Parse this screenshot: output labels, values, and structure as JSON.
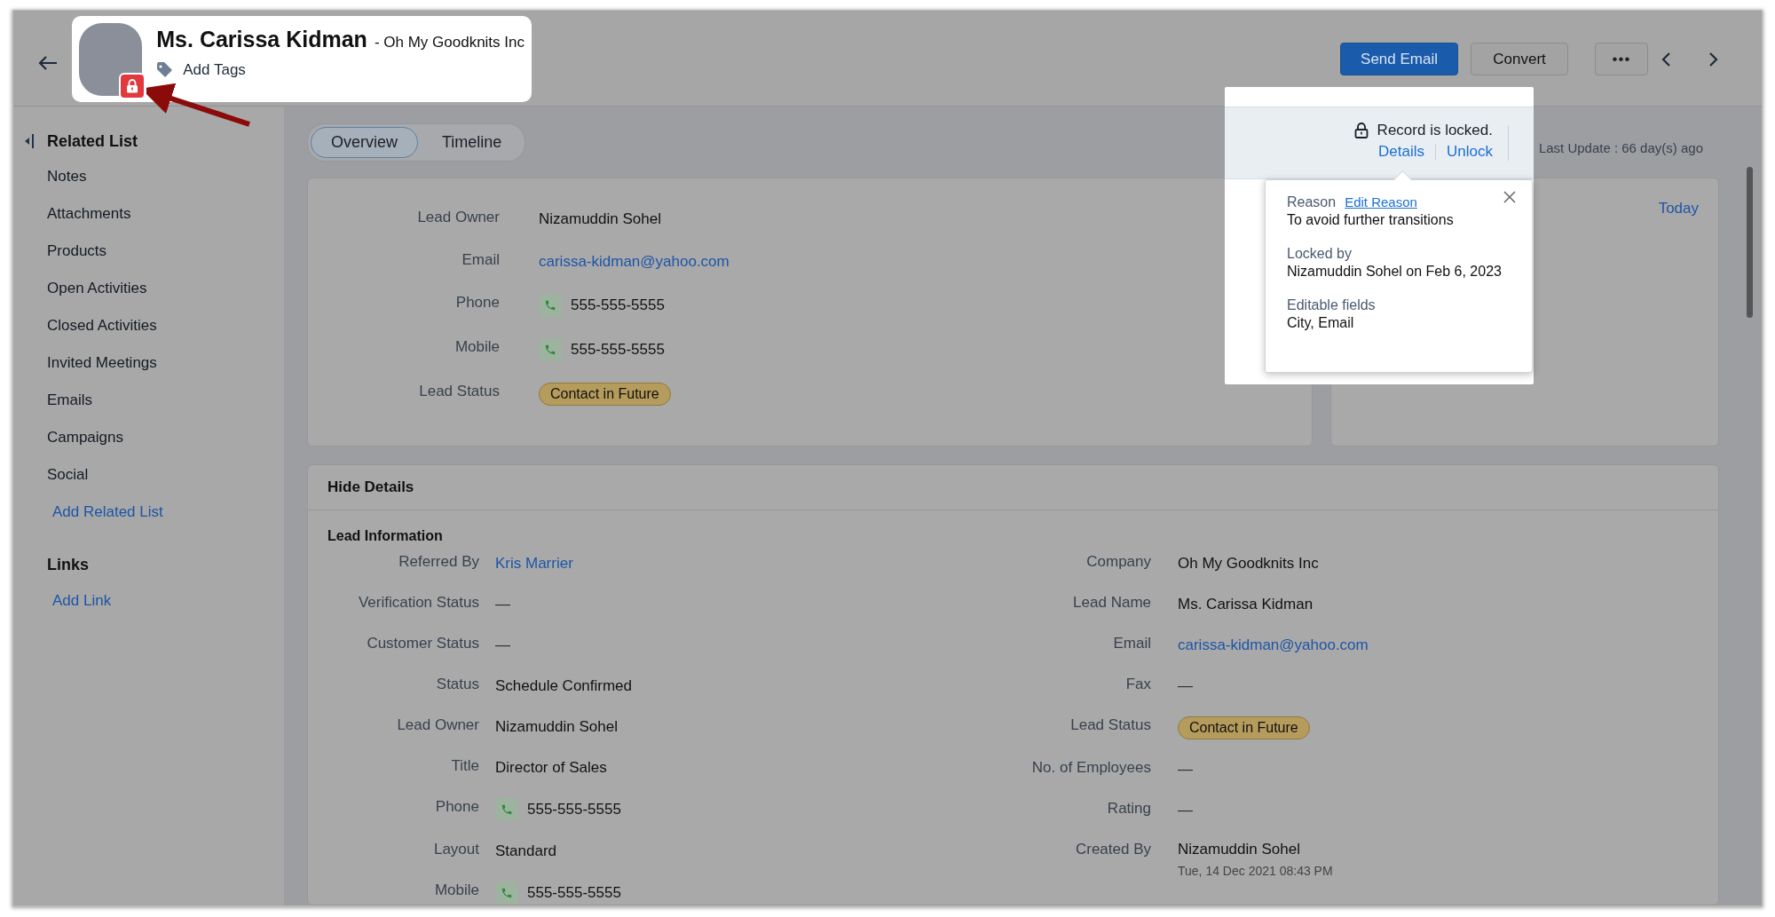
{
  "header": {
    "name": "Ms. Carissa Kidman",
    "company": "- Oh My Goodknits Inc",
    "add_tags": "Add Tags",
    "locked": true
  },
  "actions": [
    {
      "label": "Send Email",
      "kind": "primary"
    },
    {
      "label": "Convert",
      "kind": "secondary"
    },
    {
      "label": "•••",
      "kind": "more"
    }
  ],
  "sidebar": {
    "title": "Related List",
    "items": [
      "Notes",
      "Attachments",
      "Products",
      "Open Activities",
      "Closed Activities",
      "Invited Meetings",
      "Emails",
      "Campaigns",
      "Social"
    ],
    "add_related": "Add Related List",
    "links_title": "Links",
    "add_link": "Add Link"
  },
  "tabs": [
    {
      "label": "Overview",
      "selected": true
    },
    {
      "label": "Timeline",
      "selected": false
    }
  ],
  "lock_banner": {
    "message": "Record is locked.",
    "links": [
      "Details",
      "Unlock"
    ],
    "last_update": "Last Update : 66 day(s) ago"
  },
  "lock_popover": {
    "reason_label": "Reason",
    "edit_reason": "Edit Reason",
    "reason": "To avoid further transitions",
    "locked_by_label": "Locked by",
    "locked_by": "Nizamuddin Sohel on Feb 6, 2023",
    "editable_label": "Editable fields",
    "editable": "City, Email"
  },
  "overview": {
    "fields": [
      {
        "label": "Lead Owner",
        "value": "Nizamuddin Sohel",
        "kind": "text"
      },
      {
        "label": "Email",
        "value": "carissa-kidman@yahoo.com",
        "kind": "link"
      },
      {
        "label": "Phone",
        "value": "555-555-5555",
        "kind": "phone"
      },
      {
        "label": "Mobile",
        "value": "555-555-5555",
        "kind": "phone"
      },
      {
        "label": "Lead Status",
        "value": "Contact in Future",
        "kind": "tag"
      }
    ]
  },
  "activity_card": {
    "today": "Today"
  },
  "details": {
    "toggle": "Hide Details",
    "section": "Lead Information",
    "left": [
      {
        "label": "Referred By",
        "value": "Kris Marrier",
        "kind": "link"
      },
      {
        "label": "Verification Status",
        "value": "—",
        "kind": "empty"
      },
      {
        "label": "Customer Status",
        "value": "—",
        "kind": "empty"
      },
      {
        "label": "Status",
        "value": "Schedule Confirmed",
        "kind": "text"
      },
      {
        "label": "Lead Owner",
        "value": "Nizamuddin Sohel",
        "kind": "text"
      },
      {
        "label": "Title",
        "value": "Director of Sales",
        "kind": "text"
      },
      {
        "label": "Phone",
        "value": "555-555-5555",
        "kind": "phone"
      },
      {
        "label": "Layout",
        "value": "Standard",
        "kind": "text"
      },
      {
        "label": "Mobile",
        "value": "555-555-5555",
        "kind": "phone"
      }
    ],
    "right": [
      {
        "label": "Company",
        "value": "Oh My Goodknits Inc",
        "kind": "text"
      },
      {
        "label": "Lead Name",
        "value": "Ms. Carissa Kidman",
        "kind": "text"
      },
      {
        "label": "Email",
        "value": "carissa-kidman@yahoo.com",
        "kind": "link"
      },
      {
        "label": "Fax",
        "value": "—",
        "kind": "empty"
      },
      {
        "label": "Lead Status",
        "value": "Contact in Future",
        "kind": "tag"
      },
      {
        "label": "No. of Employees",
        "value": "—",
        "kind": "empty"
      },
      {
        "label": "Rating",
        "value": "—",
        "kind": "empty"
      },
      {
        "label": "Created By",
        "value": "Nizamuddin Sohel",
        "kind": "text",
        "sub": "Tue, 14 Dec 2021 08:43 PM"
      }
    ]
  }
}
